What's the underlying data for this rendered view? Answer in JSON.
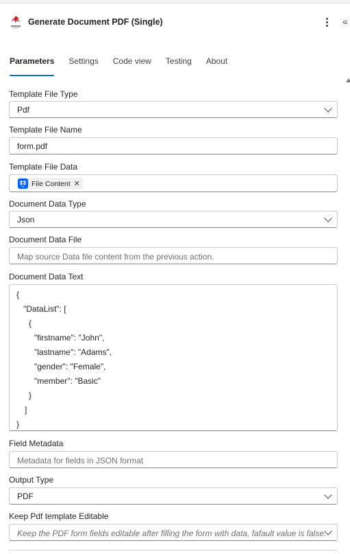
{
  "header": {
    "title": "Generate Document PDF (Single)",
    "more_icon": "more-vertical-icon",
    "collapse_label": "«"
  },
  "tabs": [
    {
      "label": "Parameters",
      "active": true
    },
    {
      "label": "Settings",
      "active": false
    },
    {
      "label": "Code view",
      "active": false
    },
    {
      "label": "Testing",
      "active": false
    },
    {
      "label": "About",
      "active": false
    }
  ],
  "fields": {
    "template_file_type": {
      "label": "Template File Type",
      "value": "Pdf"
    },
    "template_file_name": {
      "label": "Template File Name",
      "value": "form.pdf"
    },
    "template_file_data": {
      "label": "Template File Data",
      "token": "File Content",
      "token_close": "✕",
      "token_icon": "dropbox-icon"
    },
    "document_data_type": {
      "label": "Document Data Type",
      "value": "Json"
    },
    "document_data_file": {
      "label": "Document Data File",
      "placeholder": "Map source Data file content from the previous action."
    },
    "document_data_text": {
      "label": "Document Data Text",
      "lines": [
        "{",
        "\"DataList\": [",
        "{",
        "\"firstname\": \"John\",",
        "\"lastname\": \"Adams\",",
        "\"gender\": \"Female\",",
        "\"member\": \"Basic\"",
        "}",
        "]",
        "}"
      ]
    },
    "field_metadata": {
      "label": "Field Metadata",
      "placeholder": "Metadata for fields in JSON format"
    },
    "output_type": {
      "label": "Output Type",
      "value": "PDF"
    },
    "keep_editable": {
      "label": "Keep Pdf template Editable",
      "placeholder": "Keep the PDF form fields editable after filling the form with data, fafault value is false."
    }
  },
  "colors": {
    "accent": "#0f6cbd",
    "dropbox": "#0061fe",
    "brand_red": "#c4262e"
  }
}
